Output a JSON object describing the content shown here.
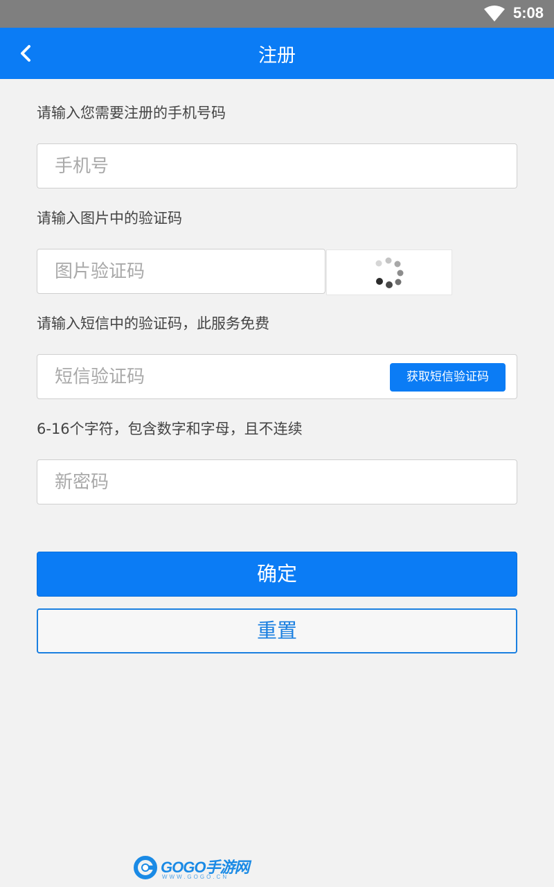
{
  "status_bar": {
    "time": "5:08",
    "wifi_icon": "wifi-icon"
  },
  "app_bar": {
    "title": "注册",
    "back_icon": "chevron-left-icon"
  },
  "form": {
    "phone_label": "请输入您需要注册的手机号码",
    "phone_placeholder": "手机号",
    "captcha_label": "请输入图片中的验证码",
    "captcha_placeholder": "图片验证码",
    "captcha_image_icon": "loading-spinner-icon",
    "sms_label": "请输入短信中的验证码，此服务免费",
    "sms_placeholder": "短信验证码",
    "sms_button": "获取短信验证码",
    "password_label": "6-16个字符，包含数字和字母，且不连续",
    "password_placeholder": "新密码"
  },
  "buttons": {
    "confirm": "确定",
    "reset": "重置"
  },
  "watermark": {
    "brand": "GOGO手游网",
    "url": "WWW.GOGO.CN"
  },
  "colors": {
    "primary": "#0b7cf5",
    "background": "#f2f2f2",
    "status_bar": "#7f7f7f"
  }
}
